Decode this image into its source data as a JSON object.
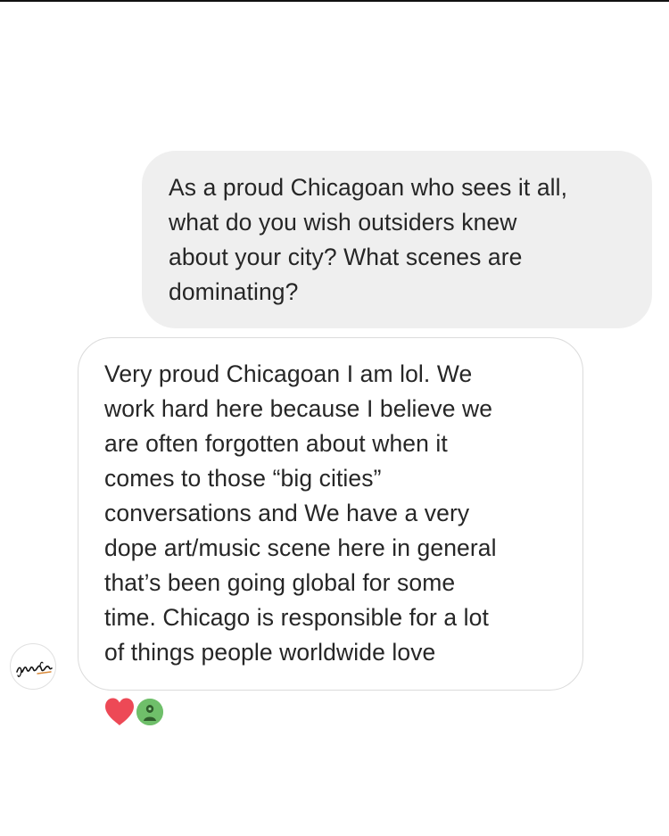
{
  "thread": {
    "sent_message": {
      "lines": [
        "As a proud Chicagoan who sees it all,",
        "what do you wish outsiders knew",
        "about your city? What scenes are",
        "dominating?"
      ]
    },
    "received_message": {
      "lines": [
        "Very proud Chicagoan I am lol. We",
        "work hard here because I believe we",
        "are often forgotten about when it",
        "comes to those “big cities”",
        "conversations and We have a very",
        "dope art/music scene here in general",
        "that’s been going global for some",
        "time. Chicago is responsible for a lot",
        "of things people worldwide love"
      ]
    },
    "sender_avatar": {
      "icon": "signature-logo-icon"
    },
    "reactions": [
      {
        "icon": "heart-icon",
        "color": "#ed4956"
      },
      {
        "icon": "user-avatar-icon",
        "color": "#6fbf6a"
      }
    ]
  },
  "colors": {
    "sent_bubble_bg": "#efefef",
    "received_bubble_border": "#dbdbdb",
    "text": "#262626",
    "heart": "#ed4956"
  }
}
